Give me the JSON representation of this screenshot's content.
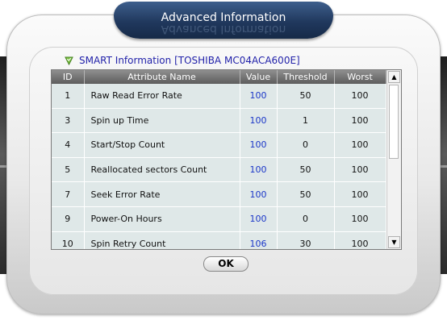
{
  "dialog": {
    "title": "Advanced Information",
    "smart_label": "SMART Information [TOSHIBA MC04ACA600E]",
    "ok_label": "OK"
  },
  "table": {
    "headers": [
      "ID",
      "Attribute Name",
      "Value",
      "Threshold",
      "Worst"
    ],
    "rows": [
      {
        "id": "1",
        "name": "Raw Read Error Rate",
        "value": "100",
        "threshold": "50",
        "worst": "100"
      },
      {
        "id": "3",
        "name": "Spin up Time",
        "value": "100",
        "threshold": "1",
        "worst": "100"
      },
      {
        "id": "4",
        "name": "Start/Stop Count",
        "value": "100",
        "threshold": "0",
        "worst": "100"
      },
      {
        "id": "5",
        "name": "Reallocated sectors Count",
        "value": "100",
        "threshold": "50",
        "worst": "100"
      },
      {
        "id": "7",
        "name": "Seek Error Rate",
        "value": "100",
        "threshold": "50",
        "worst": "100"
      },
      {
        "id": "9",
        "name": "Power-On Hours",
        "value": "100",
        "threshold": "0",
        "worst": "100"
      },
      {
        "id": "10",
        "name": "Spin Retry Count",
        "value": "106",
        "threshold": "30",
        "worst": "100"
      }
    ]
  },
  "icons": {
    "shield": "shield-check-icon",
    "scroll_up": "chevron-up-icon",
    "scroll_down": "chevron-down-icon"
  },
  "colors": {
    "title_bar": "#20385d",
    "value_text": "#1a36c8",
    "label_text": "#2222aa",
    "table_bg": "#dfe8e8"
  }
}
